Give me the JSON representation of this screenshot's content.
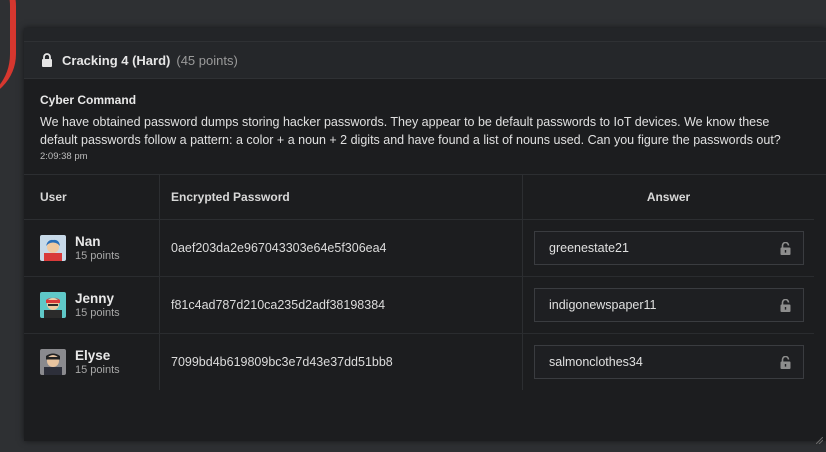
{
  "challenge": {
    "title": "Cracking 4 (Hard)",
    "points": "(45 points)",
    "lock_icon": "lock-icon"
  },
  "message": {
    "author": "Cyber Command",
    "text": "We have obtained password dumps storing hacker passwords. They appear to be default passwords to IoT devices. We know these default passwords follow a pattern: a color + a noun + 2 digits and have found a list of nouns used. Can you figure the passwords out?",
    "time": "2:09:38 pm"
  },
  "table": {
    "headers": {
      "user": "User",
      "password": "Encrypted Password",
      "answer": "Answer"
    },
    "rows": [
      {
        "name": "Nan",
        "points": "15 points",
        "hash": "0aef203da2e967043303e64e5f306ea4",
        "answer": "greenestate21"
      },
      {
        "name": "Jenny",
        "points": "15 points",
        "hash": "f81c4ad787d210ca235d2adf38198384",
        "answer": "indigonewspaper11"
      },
      {
        "name": "Elyse",
        "points": "15 points",
        "hash": "7099bd4b619809bc3e7d43e37dd51bb8",
        "answer": "salmonclothes34"
      }
    ]
  },
  "colors": {
    "background": "#2e3033",
    "panel": "#1c1d1f",
    "accent_red": "#d6372f"
  }
}
